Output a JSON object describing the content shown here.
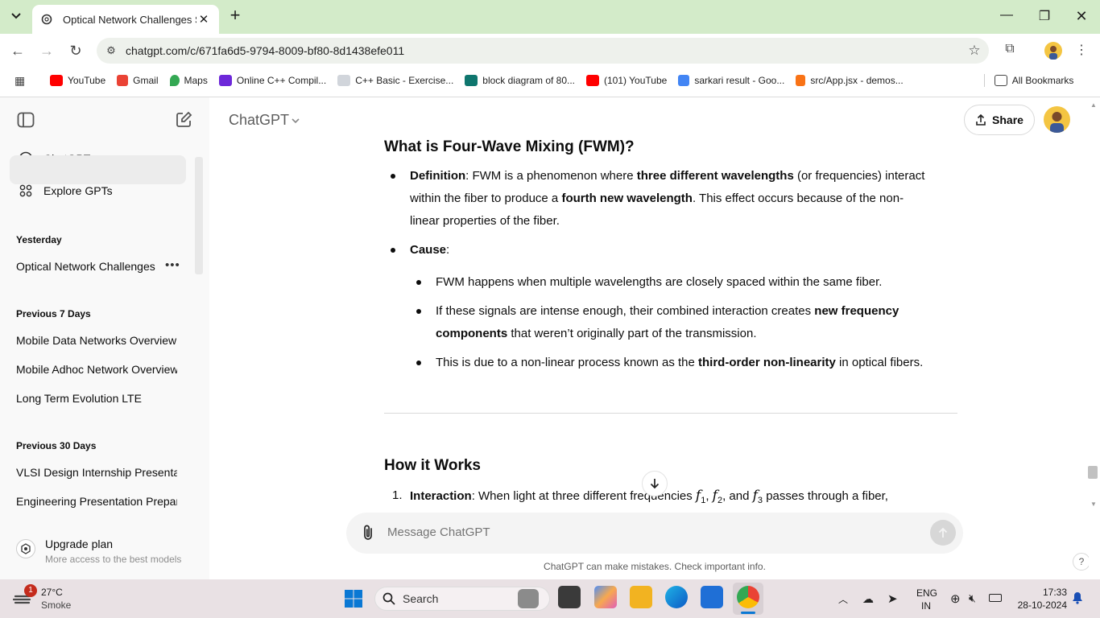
{
  "browser": {
    "tab_title": "Optical Network Challenges Su",
    "url": "chatgpt.com/c/671fa6d5-9794-8009-bf80-8d1438efe011",
    "bookmarks": [
      {
        "label": "YouTube",
        "color": "#ff0000"
      },
      {
        "label": "Gmail",
        "color": "#ea4335"
      },
      {
        "label": "Maps",
        "color": "#34a853"
      },
      {
        "label": "Online C++ Compil...",
        "color": "#6d28d9"
      },
      {
        "label": "C++ Basic - Exercise...",
        "color": "#9ca3af"
      },
      {
        "label": "block diagram of 80...",
        "color": "#0f766e"
      },
      {
        "label": "(101) YouTube",
        "color": "#ff0000"
      },
      {
        "label": "sarkari result - Goo...",
        "color": "#4285f4"
      },
      {
        "label": "src/App.jsx - demos...",
        "color": "#f97316"
      }
    ],
    "all_bookmarks": "All Bookmarks"
  },
  "sidebar": {
    "nav": [
      {
        "label": "ChatGPT"
      },
      {
        "label": "Explore GPTs"
      }
    ],
    "sections": [
      {
        "heading": "Yesterday",
        "items": [
          "Optical Network Challenges"
        ]
      },
      {
        "heading": "Previous 7 Days",
        "items": [
          "Mobile Data Networks Overview",
          "Mobile Adhoc Network Overview",
          "Long Term Evolution LTE"
        ]
      },
      {
        "heading": "Previous 30 Days",
        "items": [
          "VLSI Design Internship Presentat",
          "Engineering Presentation Prepar"
        ]
      }
    ],
    "upgrade_title": "Upgrade plan",
    "upgrade_sub": "More access to the best models"
  },
  "header": {
    "model": "ChatGPT",
    "share": "Share"
  },
  "message": {
    "heading": "What is Four-Wave Mixing (FWM)?",
    "def_label": "Definition",
    "def_1": ": FWM is a phenomenon where ",
    "def_2": "three different wavelengths",
    "def_3": " (or frequencies) interact",
    "def_4": "within the fiber to produce a ",
    "def_5": "fourth new wavelength",
    "def_6": ". This effect occurs because of the non-",
    "def_7": "linear properties of the fiber.",
    "cause_label": "Cause",
    "cause_colon": ":",
    "sub1": "FWM happens when multiple wavelengths are closely spaced within the same fiber.",
    "sub2_a": "If these signals are intense enough, their combined interaction creates ",
    "sub2_b": "new frequency",
    "sub2_c": "components",
    "sub2_d": " that weren’t originally part of the transmission.",
    "sub3_a": "This is due to a non-linear process known as the ",
    "sub3_b": "third-order non-linearity",
    "sub3_c": " in optical fibers.",
    "heading2": "How it Works",
    "step_num": "1.",
    "step_label": "Interaction",
    "step_text_a": ": When light at three different frequencies ",
    "f1": "f",
    "sub_1": "1",
    "f2": "f",
    "sub_2": "2",
    "and": ", and ",
    "f3": "f",
    "sub_3": "3",
    "comma": ",",
    "step_text_b": " passes through a fiber,"
  },
  "composer": {
    "placeholder": "Message ChatGPT",
    "disclaimer": "ChatGPT can make mistakes. Check important info.",
    "help": "?"
  },
  "taskbar": {
    "weather_temp": "27°C",
    "weather_desc": "Smoke",
    "weather_badge": "1",
    "search": "Search",
    "lang_1": "ENG",
    "lang_2": "IN",
    "time": "17:33",
    "date": "28-10-2024"
  }
}
